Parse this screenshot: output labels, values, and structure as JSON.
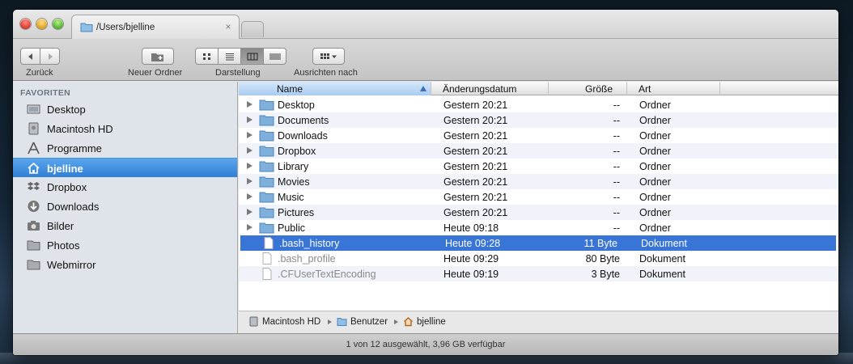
{
  "tab": {
    "title": "/Users/bjelline",
    "close_glyph": "×"
  },
  "toolbar": {
    "back_label": "Zurück",
    "new_folder_label": "Neuer Ordner",
    "view_label": "Darstellung",
    "arrange_label": "Ausrichten nach"
  },
  "sidebar": {
    "heading": "FAVORITEN",
    "items": [
      {
        "label": "Desktop",
        "icon": "desktop-icon"
      },
      {
        "label": "Macintosh HD",
        "icon": "hard-drive-icon"
      },
      {
        "label": "Programme",
        "icon": "applications-icon"
      },
      {
        "label": "bjelline",
        "icon": "home-icon",
        "selected": true
      },
      {
        "label": "Dropbox",
        "icon": "dropbox-icon"
      },
      {
        "label": "Downloads",
        "icon": "downloads-icon"
      },
      {
        "label": "Bilder",
        "icon": "camera-icon"
      },
      {
        "label": "Photos",
        "icon": "folder-icon"
      },
      {
        "label": "Webmirror",
        "icon": "folder-icon"
      }
    ]
  },
  "list": {
    "columns": {
      "name": "Name",
      "date": "Änderungsdatum",
      "size": "Größe",
      "kind": "Art"
    },
    "rows": [
      {
        "name": "Desktop",
        "date": "Gestern 20:21",
        "size": "--",
        "kind": "Ordner",
        "type": "folder"
      },
      {
        "name": "Documents",
        "date": "Gestern 20:21",
        "size": "--",
        "kind": "Ordner",
        "type": "folder"
      },
      {
        "name": "Downloads",
        "date": "Gestern 20:21",
        "size": "--",
        "kind": "Ordner",
        "type": "folder"
      },
      {
        "name": "Dropbox",
        "date": "Gestern 20:21",
        "size": "--",
        "kind": "Ordner",
        "type": "folder"
      },
      {
        "name": "Library",
        "date": "Gestern 20:21",
        "size": "--",
        "kind": "Ordner",
        "type": "folder"
      },
      {
        "name": "Movies",
        "date": "Gestern 20:21",
        "size": "--",
        "kind": "Ordner",
        "type": "folder"
      },
      {
        "name": "Music",
        "date": "Gestern 20:21",
        "size": "--",
        "kind": "Ordner",
        "type": "folder"
      },
      {
        "name": "Pictures",
        "date": "Gestern 20:21",
        "size": "--",
        "kind": "Ordner",
        "type": "folder"
      },
      {
        "name": "Public",
        "date": "Heute 09:18",
        "size": "--",
        "kind": "Ordner",
        "type": "folder"
      },
      {
        "name": ".bash_history",
        "date": "Heute 09:28",
        "size": "11 Byte",
        "kind": "Dokument",
        "type": "file",
        "selected": true
      },
      {
        "name": ".bash_profile",
        "date": "Heute 09:29",
        "size": "80 Byte",
        "kind": "Dokument",
        "type": "file"
      },
      {
        "name": ".CFUserTextEncoding",
        "date": "Heute 09:19",
        "size": "3 Byte",
        "kind": "Dokument",
        "type": "file"
      }
    ]
  },
  "pathbar": {
    "crumbs": [
      "Macintosh HD",
      "Benutzer",
      "bjelline"
    ]
  },
  "status": {
    "text": "1 von 12 ausgewählt, 3,96 GB verfügbar"
  },
  "colors": {
    "selection": "#3875d7",
    "sidebar_bg": "#dee4ea",
    "folder_blue": "#7fb0dc"
  }
}
